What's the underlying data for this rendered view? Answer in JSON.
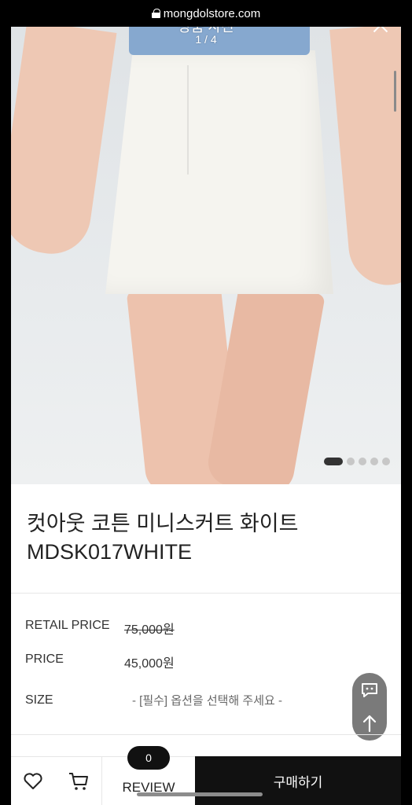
{
  "browser": {
    "url": "mongdolstore.com"
  },
  "viewer": {
    "title": "상품 사진",
    "counter": "1 / 4",
    "slide_count": 5,
    "active_slide": 0
  },
  "product": {
    "name_line1": "컷아웃 코튼 미니스커트 화이트",
    "name_line2": "MDSK017WHITE"
  },
  "pricing": {
    "retail_label": "RETAIL PRICE",
    "retail_value": "75,000원",
    "price_label": "PRICE",
    "price_value": "45,000원",
    "size_label": "SIZE",
    "size_placeholder": "- [필수] 옵션을 선택해 주세요 -"
  },
  "bottom_bar": {
    "review_count": "0",
    "review_label": "REVIEW",
    "buy_label": "구매하기"
  },
  "icons": [
    "lock-icon",
    "close-icon",
    "chat-icon",
    "arrow-up-icon",
    "heart-icon",
    "cart-icon"
  ],
  "colors": {
    "buy_bar": "#111111",
    "fab": "#7a7a7a",
    "knit_top": "#86a8cf"
  }
}
